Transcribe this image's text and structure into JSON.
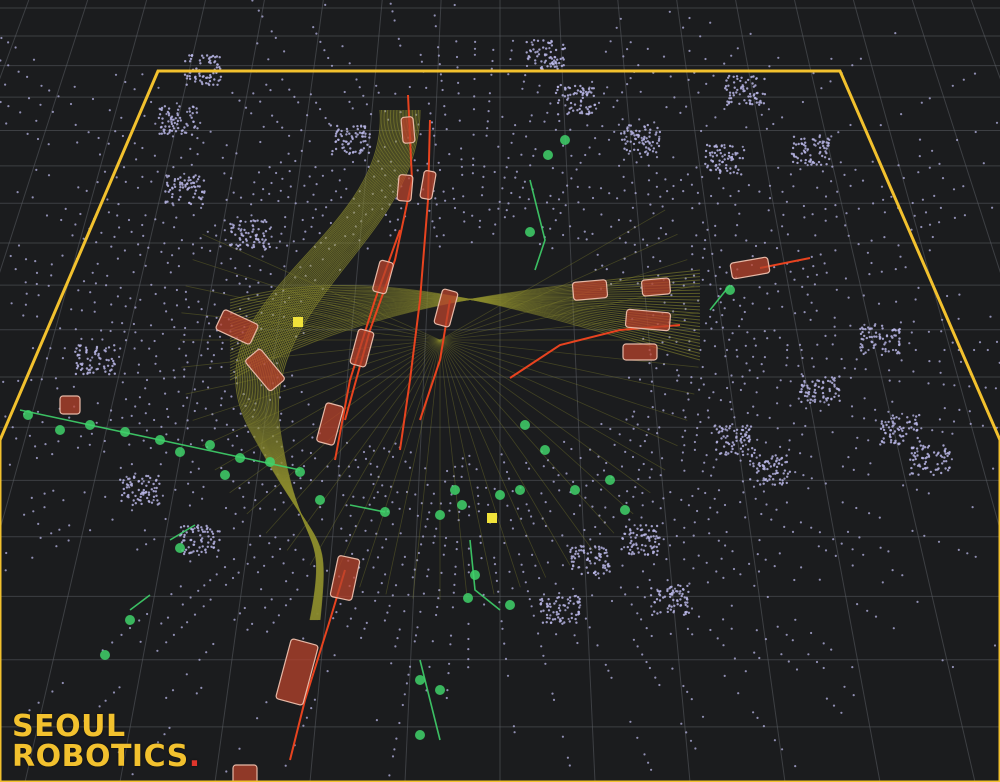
{
  "brand": {
    "line1": "SEOUL",
    "line2": "ROBOTICS",
    "dot": "."
  },
  "colors": {
    "background": "#1b1c1e",
    "grid": "#5a5d63",
    "boundary": "#f2c12e",
    "lane_lines": "#8a8a2e",
    "point_cloud": "#b8b6e6",
    "pedestrian": "#3fd16a",
    "vehicle": "#b8432c",
    "trajectory_vehicle": "#e8431f",
    "brand_yellow": "#f2c12e",
    "brand_red": "#e0362c"
  },
  "icons": {
    "vehicle": "vehicle-box-icon",
    "pedestrian": "pedestrian-marker-icon",
    "cyclist": "cyclist-marker-icon"
  }
}
